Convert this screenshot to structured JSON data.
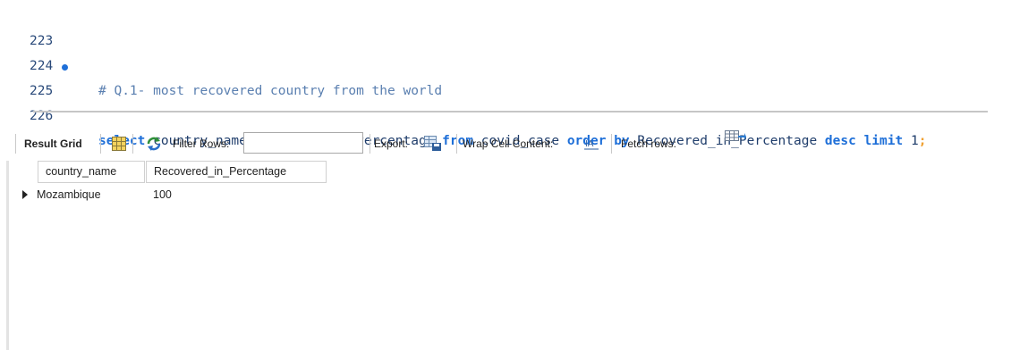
{
  "editor": {
    "lines": [
      {
        "number": "223",
        "text": ""
      },
      {
        "number": "224",
        "text": "# Q.1- most recovered country from the world"
      },
      {
        "number": "225",
        "has_marker": true,
        "tokens": [
          {
            "t": "select",
            "k": "kw"
          },
          {
            "t": " country_name",
            "k": "ident"
          },
          {
            "t": ",",
            "k": "ident"
          },
          {
            "t": "Recovered_in_Percentage ",
            "k": "ident"
          },
          {
            "t": "from",
            "k": "kw"
          },
          {
            "t": " covid_case ",
            "k": "ident"
          },
          {
            "t": "order by",
            "k": "kw"
          },
          {
            "t": " Recovered_in_Percentage ",
            "k": "ident"
          },
          {
            "t": "desc",
            "k": "kw"
          },
          {
            "t": " ",
            "k": "ident"
          },
          {
            "t": "limit",
            "k": "kw"
          },
          {
            "t": " 1",
            "k": "ident"
          },
          {
            "t": ";",
            "k": "punct"
          }
        ]
      },
      {
        "number": "226",
        "text": ""
      }
    ]
  },
  "toolbar": {
    "result_grid_label": "Result Grid",
    "filter_rows_label": "Filter Rows:",
    "filter_rows_value": "",
    "export_label": "Export:",
    "wrap_cell_label": "Wrap Cell Content:",
    "fetch_rows_label": "Fetch rows:"
  },
  "grid": {
    "columns": [
      "country_name",
      "Recovered_in_Percentage"
    ],
    "rows": [
      [
        "Mozambique",
        "100"
      ]
    ]
  },
  "icons": {
    "grid_view": "grid-view-icon",
    "refresh": "refresh-icon",
    "export": "export-icon",
    "wrap": "wrap-cell-icon",
    "fetch": "fetch-rows-icon"
  },
  "colors": {
    "keyword": "#1e6fd8",
    "comment": "#5a7fb0",
    "identifier": "#1f3d6b",
    "line_number": "#2a4a7a",
    "semicolon": "#f0a030"
  }
}
